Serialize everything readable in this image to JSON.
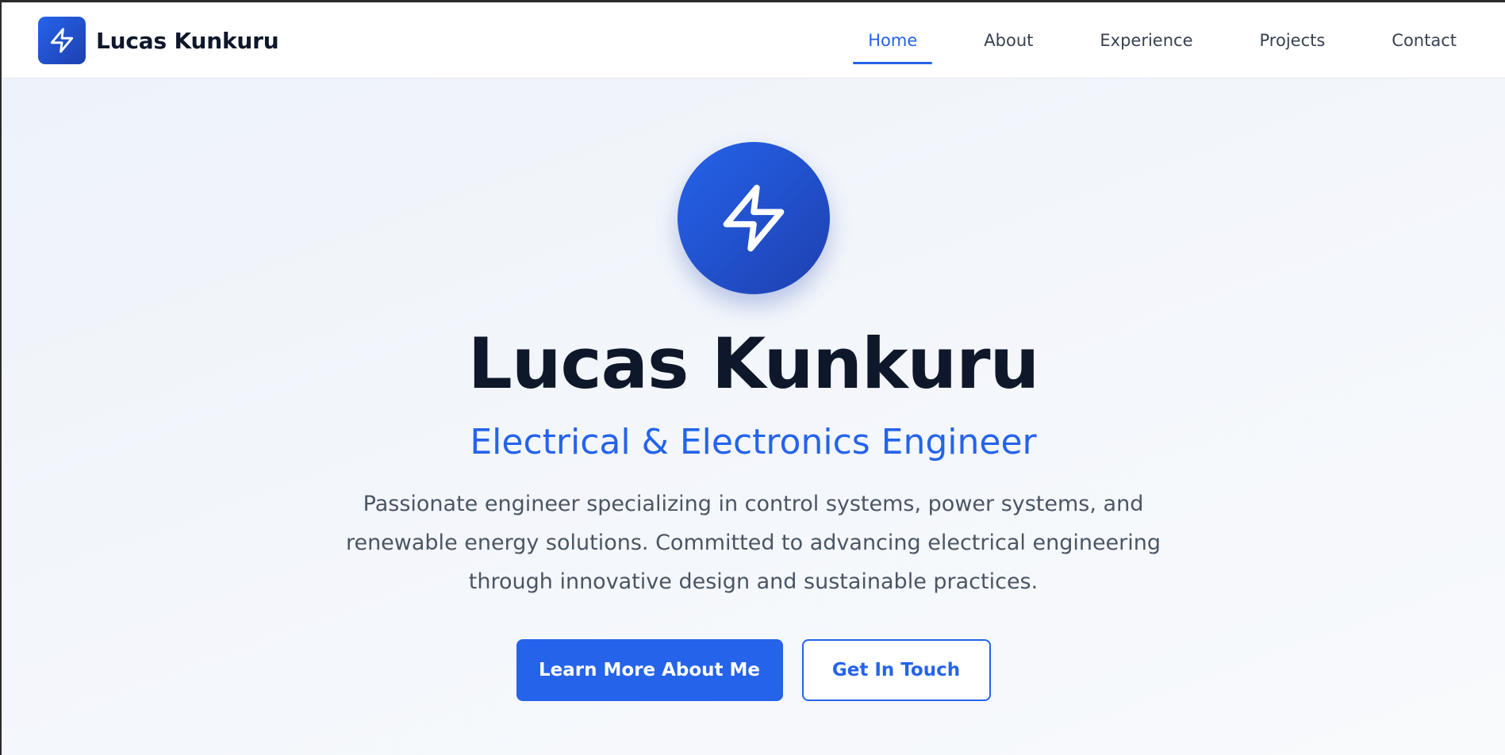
{
  "brand": {
    "name": "Lucas Kunkuru",
    "icon": "lightning-bolt-icon"
  },
  "nav": {
    "items": [
      {
        "label": "Home",
        "active": true
      },
      {
        "label": "About",
        "active": false
      },
      {
        "label": "Experience",
        "active": false
      },
      {
        "label": "Projects",
        "active": false
      },
      {
        "label": "Contact",
        "active": false
      }
    ]
  },
  "hero": {
    "icon": "lightning-bolt-icon",
    "name": "Lucas Kunkuru",
    "title": "Electrical & Electronics Engineer",
    "description": "Passionate engineer specializing in control systems, power systems, and renewable energy solutions. Committed to advancing electrical engineering through innovative design and sustainable practices.",
    "primary_button": "Learn More About Me",
    "secondary_button": "Get In Touch"
  },
  "colors": {
    "accent": "#2563eb",
    "accent_dark": "#1e40af",
    "heading": "#0f172a",
    "body_text": "#4b5563"
  }
}
